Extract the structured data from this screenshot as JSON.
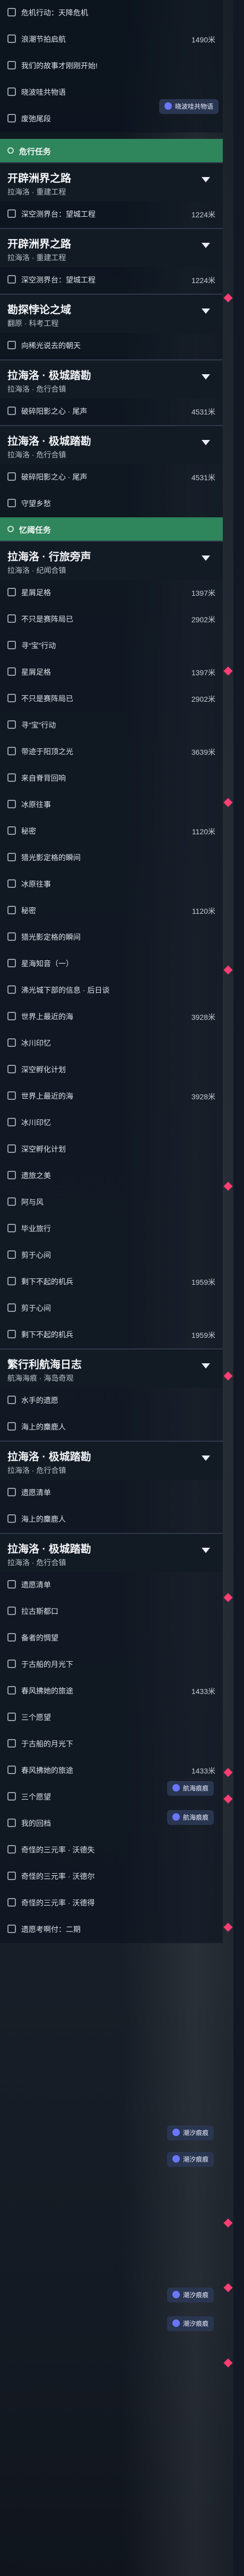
{
  "header": {
    "items": [
      {
        "label": "危机行动：天降危机",
        "distance": ""
      },
      {
        "label": "浪潮节拍启航",
        "distance": "1490米"
      },
      {
        "label": "我们的故事才刚刚开始!",
        "distance": ""
      },
      {
        "label": "晓波哇共物语",
        "distance": ""
      },
      {
        "label": "废弛尾段",
        "distance": ""
      }
    ],
    "badge_label": "晓波哇共物语"
  },
  "sections": [
    {
      "type": "category",
      "label": "危行任务"
    },
    {
      "type": "quest",
      "title": "开辟洲界之路",
      "location": "拉海洛 · 重建工程"
    },
    {
      "type": "row",
      "label": "深空测界台：望城工程",
      "distance": "1224米"
    },
    {
      "type": "quest",
      "title": "开辟洲界之路",
      "location": "拉海洛 · 重建工程"
    },
    {
      "type": "row",
      "label": "深空测界台：望城工程",
      "distance": "1224米"
    },
    {
      "type": "quest",
      "title": "勘探悖论之域",
      "location": "翻原 · 科考工程"
    },
    {
      "type": "row",
      "label": "向稀光说去的朝天",
      "distance": ""
    },
    {
      "type": "quest",
      "title": "拉海洛 · 极城踏勘",
      "location": "拉海洛 · 危行合镇"
    },
    {
      "type": "row",
      "label": "破碎阳影之心 · 尾声",
      "distance": "4531米"
    },
    {
      "type": "quest",
      "title": "拉海洛 · 极城踏勘",
      "location": "拉海洛 · 危行合镇"
    },
    {
      "type": "row",
      "label": "破碎阳影之心 · 尾声",
      "distance": "4531米"
    },
    {
      "type": "row",
      "label": "守望乡愁",
      "distance": ""
    },
    {
      "type": "category",
      "label": "忆阈任务"
    },
    {
      "type": "quest",
      "title": "拉海洛 · 行旅旁声",
      "location": "拉海洛 · 纪闻合镇"
    },
    {
      "type": "row",
      "label": "星屑足格",
      "distance": "1397米"
    },
    {
      "type": "row",
      "label": "不只是赛阵局已",
      "distance": "2902米"
    },
    {
      "type": "row",
      "label": "寻“宝”行动",
      "distance": ""
    },
    {
      "type": "row",
      "label": "星屑足格",
      "distance": "1397米"
    },
    {
      "type": "row",
      "label": "不只是赛阵局已",
      "distance": "2902米"
    },
    {
      "type": "row",
      "label": "寻“宝”行动",
      "distance": ""
    },
    {
      "type": "row",
      "label": "带迹于阳顶之光",
      "distance": "3639米"
    },
    {
      "type": "row",
      "label": "来自脊背回响",
      "distance": ""
    },
    {
      "type": "row",
      "label": "冰原往事",
      "distance": ""
    },
    {
      "type": "row",
      "label": "秘密",
      "distance": "1120米"
    },
    {
      "type": "row",
      "label": "猎光影定格的瞬间",
      "distance": ""
    },
    {
      "type": "row",
      "label": "冰原往事",
      "distance": ""
    },
    {
      "type": "row",
      "label": "秘密",
      "distance": "1120米"
    },
    {
      "type": "row",
      "label": "猎光影定格的瞬间",
      "distance": ""
    },
    {
      "type": "row",
      "label": "星海知音（一）",
      "distance": ""
    },
    {
      "type": "row",
      "label": "沸光城下部的信息 · 后日谈",
      "distance": ""
    },
    {
      "type": "row",
      "label": "世界上最近的海",
      "distance": "3928米"
    },
    {
      "type": "row",
      "label": "冰川印忆",
      "distance": ""
    },
    {
      "type": "row",
      "label": "深空孵化计划",
      "distance": ""
    },
    {
      "type": "row",
      "label": "世界上最近的海",
      "distance": "3928米"
    },
    {
      "type": "row",
      "label": "冰川印忆",
      "distance": ""
    },
    {
      "type": "row",
      "label": "深空孵化计划",
      "distance": ""
    },
    {
      "type": "row",
      "label": "遗旅之美",
      "distance": ""
    },
    {
      "type": "row",
      "label": "阿与风",
      "distance": ""
    },
    {
      "type": "row",
      "label": "毕业旅行",
      "distance": ""
    },
    {
      "type": "row",
      "label": "剪于心间",
      "distance": ""
    },
    {
      "type": "row",
      "label": "剩下不起的机兵",
      "distance": "1959米"
    },
    {
      "type": "row",
      "label": "剪于心间",
      "distance": ""
    },
    {
      "type": "row",
      "label": "剩下不起的机兵",
      "distance": "1959米"
    },
    {
      "type": "quest",
      "title": "繁行利航海日志",
      "location": "航海海痕 · 海岛奇观"
    },
    {
      "type": "row",
      "label": "水手的遗愿",
      "distance": ""
    },
    {
      "type": "row",
      "label": "海上的麋鹿人",
      "distance": ""
    },
    {
      "type": "quest",
      "title": "拉海洛 · 极城踏勘",
      "location": "拉海洛 · 危行合镇"
    },
    {
      "type": "row",
      "label": "遗愿清单",
      "distance": ""
    },
    {
      "type": "row",
      "label": "海上的麋鹿人",
      "distance": ""
    },
    {
      "type": "quest",
      "title": "拉海洛 · 极城踏勘",
      "location": "拉海洛 · 危行合镇"
    },
    {
      "type": "row",
      "label": "遗愿清单",
      "distance": ""
    },
    {
      "type": "row",
      "label": "拉古斯都口",
      "distance": ""
    },
    {
      "type": "row",
      "label": "备者的惆望",
      "distance": ""
    },
    {
      "type": "row",
      "label": "于古船的月光下",
      "distance": ""
    },
    {
      "type": "row",
      "label": "春风拂她的旅途",
      "distance": "1433米"
    },
    {
      "type": "row",
      "label": "三个愿望",
      "distance": ""
    },
    {
      "type": "row",
      "label": "于古船的月光下",
      "distance": ""
    },
    {
      "type": "row",
      "label": "春风拂她的旅途",
      "distance": "1433米"
    },
    {
      "type": "row",
      "label": "三个愿望",
      "distance": ""
    },
    {
      "type": "row",
      "label": "我的回档",
      "distance": ""
    },
    {
      "type": "row",
      "label": "奇怪的三元率 · 沃德失",
      "distance": ""
    },
    {
      "type": "row",
      "label": "奇怪的三元率 · 沃德尔",
      "distance": ""
    },
    {
      "type": "row",
      "label": "奇怪的三元率 · 沃德得",
      "distance": ""
    },
    {
      "type": "row",
      "label": "遗愿考啊付：二期",
      "distance": ""
    }
  ],
  "badges": {
    "navigation": "航海痕痕",
    "lighthouse": "潮汐痕痕"
  },
  "colors": {
    "accent": "#2f855c",
    "diamond": "#ff3e73",
    "badge_bg": "#2a3550"
  }
}
